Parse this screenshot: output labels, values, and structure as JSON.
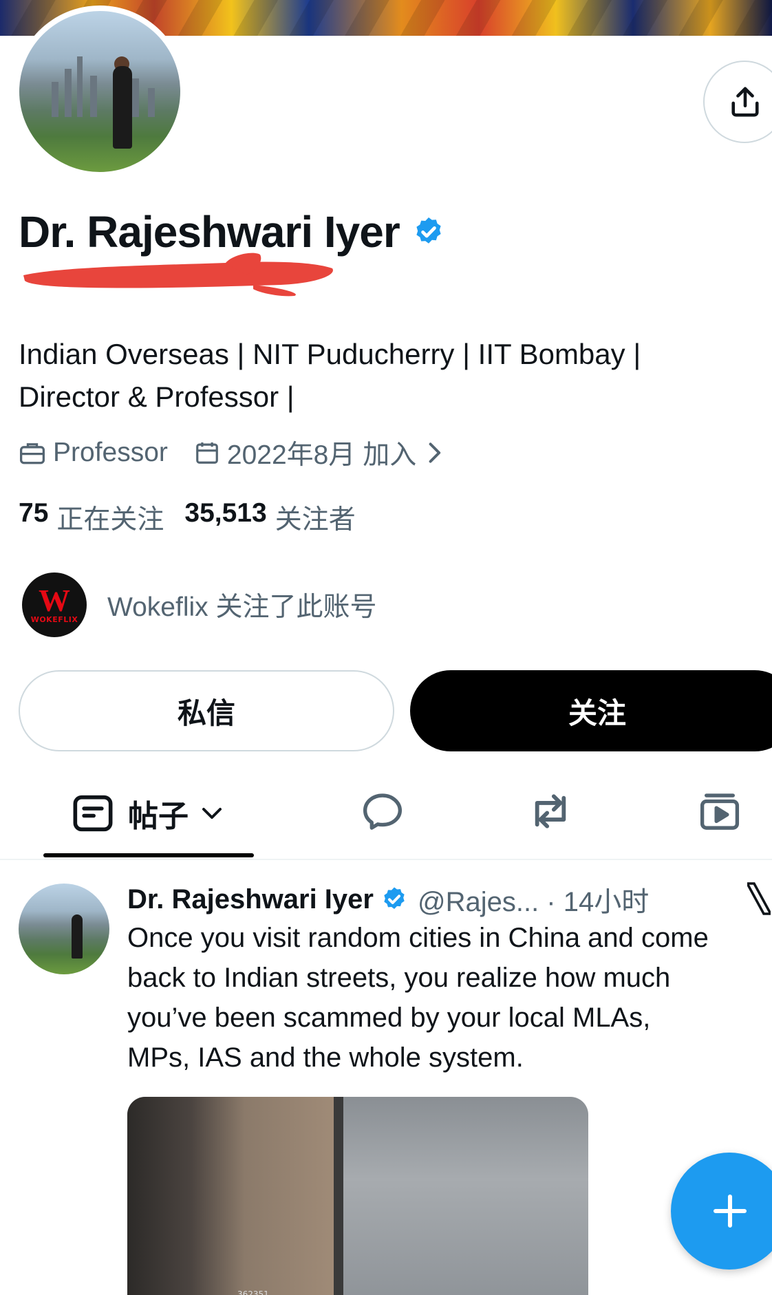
{
  "profile": {
    "name": "Dr. Rajeshwari Iyer",
    "bio": [
      "Indian Overseas | NIT Puducherry | IIT Bombay |",
      "Director & Professor |"
    ],
    "category": "Professor",
    "joined": "2022年8月 加入",
    "following_count": "75",
    "following_label": "正在关注",
    "followers_count": "35,513",
    "followers_label": "关注者",
    "followed_by": {
      "logo_letter": "W",
      "logo_text": "WOKEFLIX",
      "text": "Wokeflix 关注了此账号"
    }
  },
  "actions": {
    "dm_label": "私信",
    "follow_label": "关注"
  },
  "tabs": {
    "posts_label": "帖子"
  },
  "post": {
    "author": "Dr. Rajeshwari Iyer",
    "meta": "@Rajes... · 14小时",
    "lines": [
      "Once you visit random cities in China and come",
      "back to Indian streets, you realize how much",
      "you’ve been scammed by your local MLAs,",
      "MPs, IAS and the whole system."
    ],
    "media_caption": "362351"
  },
  "icons": {
    "share": "share-icon",
    "verified": "verified-badge-icon",
    "briefcase": "briefcase-icon",
    "calendar": "calendar-icon",
    "chevron": "chevron-right-icon",
    "posts_tab": "posts-tab-icon",
    "replies_tab": "replies-tab-icon",
    "reposts_tab": "reposts-tab-icon",
    "media_tab": "media-tab-icon",
    "compose": "compose-plus-icon",
    "x_logo": "x-logo-icon"
  },
  "colors": {
    "accent": "#1d9bf0",
    "muted": "#536471",
    "redaction": "#e8453c"
  }
}
